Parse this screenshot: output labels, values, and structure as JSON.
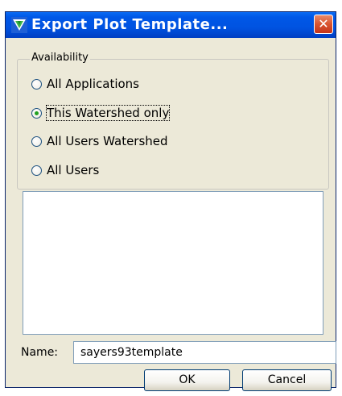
{
  "window": {
    "title": "Export Plot Template...",
    "app_icon": "watershed-app-icon",
    "close_icon": "close-icon",
    "close_glyph": "✕"
  },
  "availability": {
    "legend": "Availability",
    "options": [
      {
        "label": "All Applications",
        "checked": false
      },
      {
        "label": "This Watershed only",
        "checked": true
      },
      {
        "label": "All Users Watershed",
        "checked": false
      },
      {
        "label": "All Users",
        "checked": false
      }
    ]
  },
  "template_list": {
    "items": []
  },
  "name_field": {
    "label": "Name:",
    "value": "sayers93template"
  },
  "buttons": {
    "ok": "OK",
    "cancel": "Cancel"
  },
  "colors": {
    "title_bar": "#0053e1",
    "dialog_bg": "#ece9d8",
    "close_button": "#d9542f",
    "radio_selected_dot": "#21a121"
  }
}
